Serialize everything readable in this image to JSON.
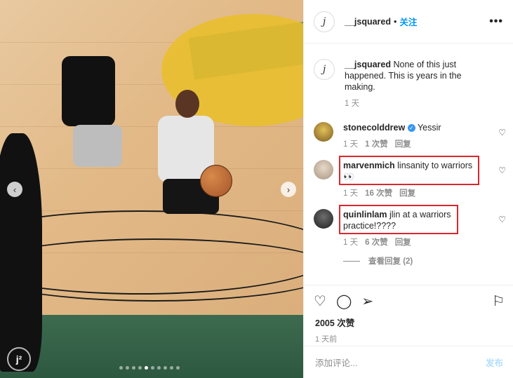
{
  "header": {
    "avatar_letter": "j",
    "username": "__jsquared",
    "separator": "•",
    "follow_label": "关注",
    "more_label": "•••"
  },
  "caption": {
    "username": "__jsquared",
    "text": "None of this just happened. This is years in the making.",
    "time": "1 天"
  },
  "comments": [
    {
      "username": "stonecolddrew",
      "verified": true,
      "text": "Yessir",
      "time": "1 天",
      "likes": "1 次赞",
      "reply": "回复"
    },
    {
      "username": "marvenmich",
      "verified": false,
      "text": "linsanity to warriors 👀",
      "time": "1 天",
      "likes": "16 次赞",
      "reply": "回复"
    },
    {
      "username": "quinlinlam",
      "verified": false,
      "text": "jlin at a warriors practice!????",
      "time": "1 天",
      "likes": "6 次赞",
      "reply": "回复",
      "view_replies": "查看回复 (2)"
    }
  ],
  "post": {
    "likes": "2005 次赞",
    "time": "1 天前",
    "comment_placeholder": "添加评论...",
    "post_label": "发布"
  },
  "colors": {
    "highlight": "#d9272e",
    "link": "#0095f6"
  }
}
